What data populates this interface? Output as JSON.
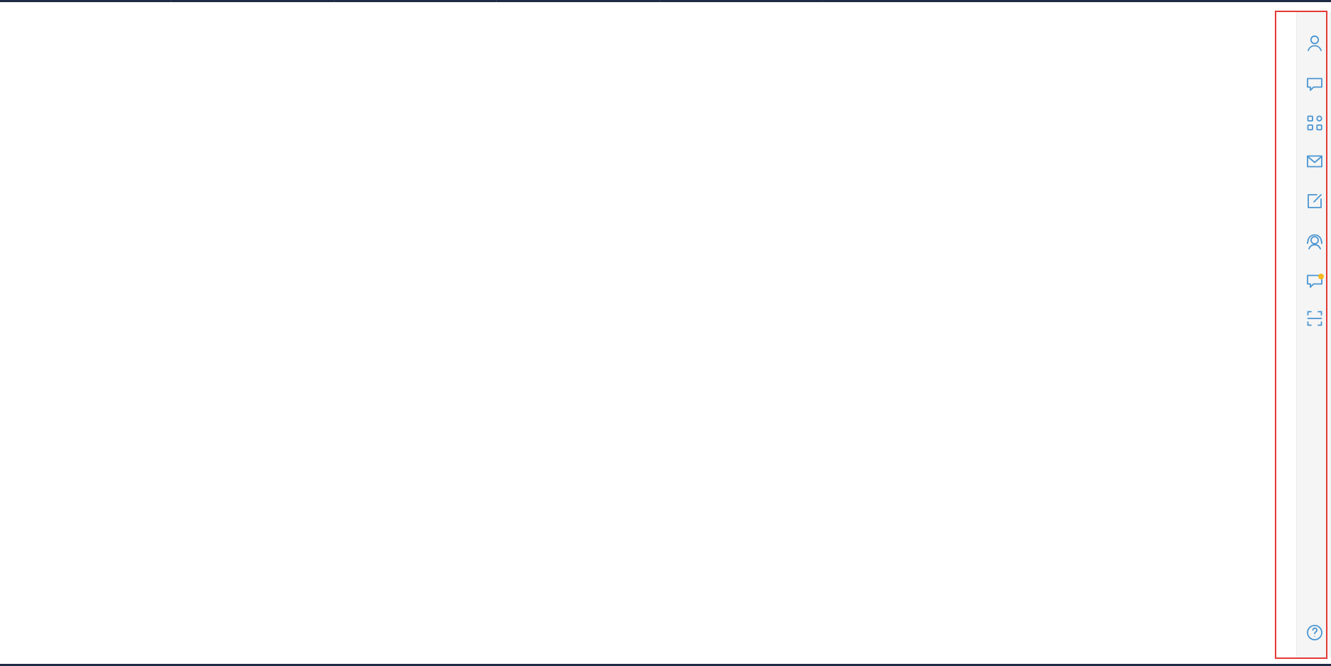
{
  "window": {
    "top_strip_color": "#1f2a44",
    "bottom_strip_color": "#1f2a44",
    "highlight_color": "#e53935"
  },
  "right_rail": {
    "background_color": "#f5f5f5",
    "icon_color": "#4a95d2",
    "notification_color": "#f6b81f",
    "items": [
      {
        "icon": "user-icon"
      },
      {
        "icon": "chat-bubble-icon"
      },
      {
        "icon": "apps-grid-icon"
      },
      {
        "icon": "mail-icon"
      },
      {
        "icon": "edit-note-icon"
      },
      {
        "icon": "support-headset-icon"
      },
      {
        "icon": "feedback-chat-icon",
        "notification": true
      },
      {
        "icon": "scan-frame-icon"
      },
      {
        "icon": "help-icon"
      }
    ]
  }
}
